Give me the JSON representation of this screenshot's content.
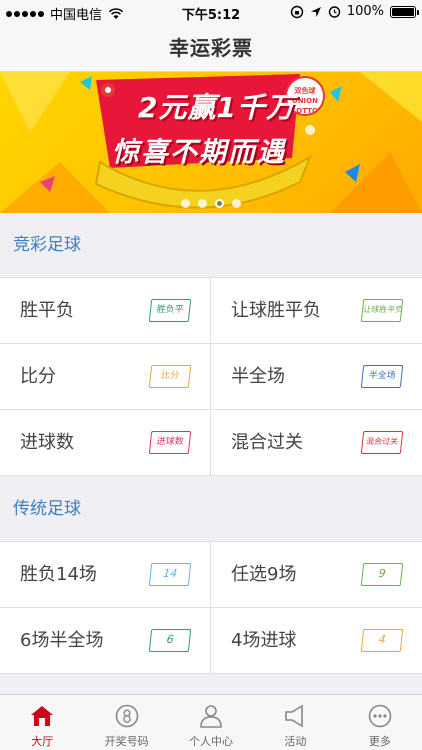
{
  "status_bar": {
    "carrier": "中国电信",
    "time": "下午5:12",
    "battery": "100%"
  },
  "nav": {
    "title": "幸运彩票"
  },
  "banner": {
    "headline": "2元赢1千万",
    "slogan": "惊喜不期而遇",
    "logo_text_line1": "双色球",
    "logo_text_line2": "UNION",
    "logo_text_line3": "LOTTO",
    "page_count": 4,
    "active_page": 3
  },
  "sections": [
    {
      "title": "竞彩足球",
      "items": [
        {
          "label": "胜平负",
          "ticket": "胜负平",
          "color": "#2e9e6a"
        },
        {
          "label": "让球胜平负",
          "ticket": "让球胜平负",
          "color": "#6ab04c"
        },
        {
          "label": "比分",
          "ticket": "比分",
          "color": "#f0a040"
        },
        {
          "label": "半全场",
          "ticket": "半全场",
          "color": "#3f6fc4"
        },
        {
          "label": "进球数",
          "ticket": "进球数",
          "color": "#e0306a"
        },
        {
          "label": "混合过关",
          "ticket": "混合过关",
          "color": "#d8333b"
        }
      ]
    },
    {
      "title": "传统足球",
      "items": [
        {
          "label": "胜负14场",
          "ticket": "14",
          "color": "#63b8dc"
        },
        {
          "label": "任选9场",
          "ticket": "9",
          "color": "#6ab04c"
        },
        {
          "label": "6场半全场",
          "ticket": "6",
          "color": "#2e9e6a"
        },
        {
          "label": "4场进球",
          "ticket": "4",
          "color": "#f0a040"
        }
      ]
    }
  ],
  "tabs": [
    {
      "label": "大厅",
      "icon": "home-icon",
      "active": true
    },
    {
      "label": "开奖号码",
      "icon": "lottery-ball-icon",
      "active": false
    },
    {
      "label": "个人中心",
      "icon": "person-icon",
      "active": false
    },
    {
      "label": "活动",
      "icon": "megaphone-icon",
      "active": false
    },
    {
      "label": "更多",
      "icon": "more-icon",
      "active": false
    }
  ],
  "colors": {
    "accent_blue": "#3d7fc4",
    "active_tab": "#d0021b"
  }
}
